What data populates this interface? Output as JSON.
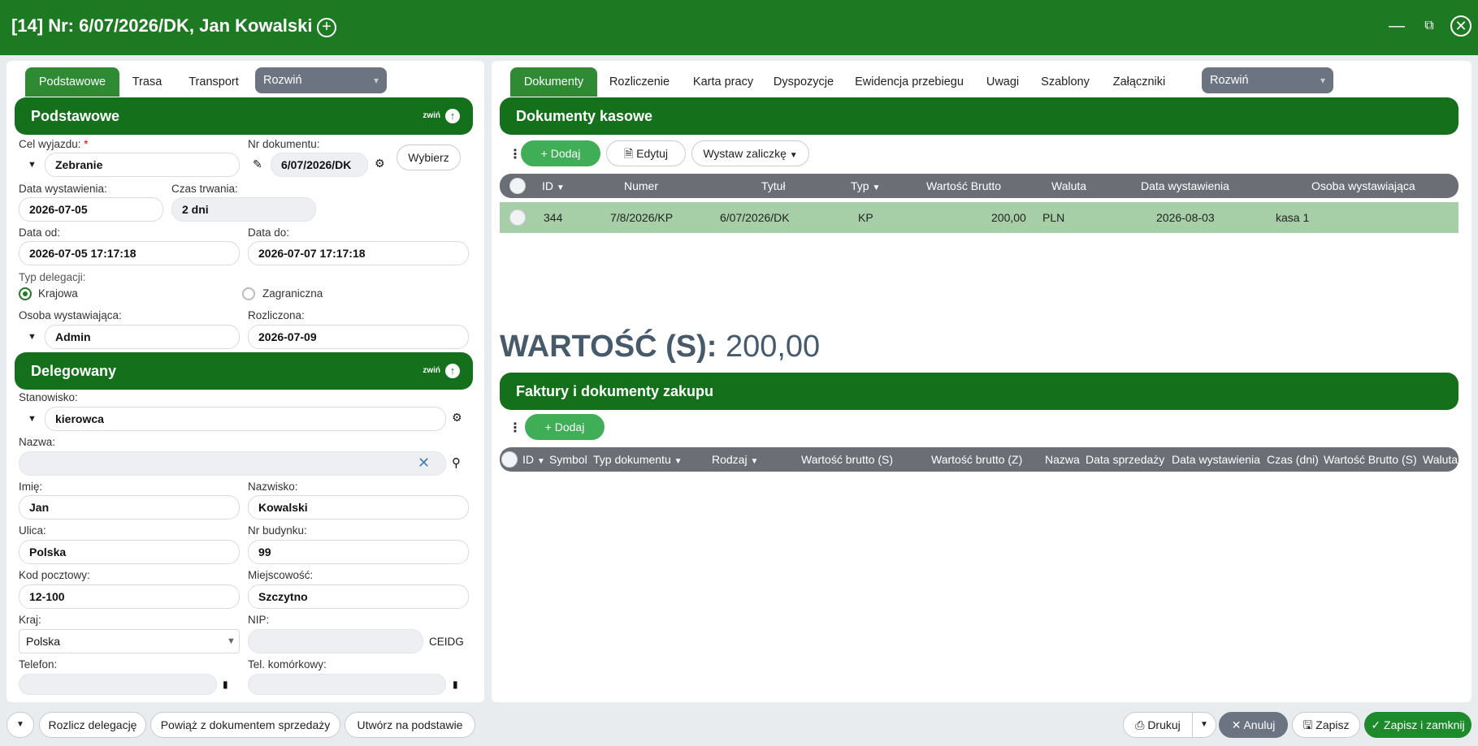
{
  "window": {
    "title": "[14] Nr: 6/07/2026/DK, Jan Kowalski"
  },
  "left_tabs": [
    {
      "label": "Podstawowe"
    },
    {
      "label": "Trasa"
    },
    {
      "label": "Transport"
    }
  ],
  "left_rozwin": "Rozwiń",
  "sections": {
    "podstawowe": "Podstawowe",
    "delegowany": "Delegowany",
    "collapse": "zwiń"
  },
  "form": {
    "cel_label": "Cel wyjazdu:",
    "cel_req": "*",
    "cel_value": "Zebranie",
    "nr_label": "Nr dokumentu:",
    "nr_value": "6/07/2026/DK",
    "wybierz": "Wybierz",
    "data_wyst_label": "Data wystawienia:",
    "data_wyst_value": "2026-07-05",
    "czas_label": "Czas trwania:",
    "czas_value": "2 dni",
    "data_od_label": "Data od:",
    "data_od_value": "2026-07-05 17:17:18",
    "data_do_label": "Data do:",
    "data_do_value": "2026-07-07 17:17:18",
    "typ_label": "Typ delegacji:",
    "typ_krajowa": "Krajowa",
    "typ_zagraniczna": "Zagraniczna",
    "osoba_label": "Osoba wystawiająca:",
    "osoba_value": "Admin",
    "rozl_label": "Rozliczona:",
    "rozl_value": "2026-07-09",
    "stan_label": "Stanowisko:",
    "stan_value": "kierowca",
    "nazwa_label": "Nazwa:",
    "nazwa_value": "",
    "imie_label": "Imię:",
    "imie_value": "Jan",
    "nazwisko_label": "Nazwisko:",
    "nazwisko_value": "Kowalski",
    "ulica_label": "Ulica:",
    "ulica_value": "Polska",
    "nrbud_label": "Nr budynku:",
    "nrbud_value": "99",
    "kod_label": "Kod pocztowy:",
    "kod_value": "12-100",
    "miejsc_label": "Miejscowość:",
    "miejsc_value": "Szczytno",
    "kraj_label": "Kraj:",
    "kraj_value": "Polska",
    "nip_label": "NIP:",
    "nip_value": "",
    "ceidg": "CEIDG",
    "tel_label": "Telefon:",
    "tel_value": "",
    "telkom_label": "Tel. komórkowy:",
    "telkom_value": ""
  },
  "right_tabs": [
    {
      "label": "Dokumenty"
    },
    {
      "label": "Rozliczenie"
    },
    {
      "label": "Karta pracy"
    },
    {
      "label": "Dyspozycje"
    },
    {
      "label": "Ewidencja przebiegu"
    },
    {
      "label": "Uwagi"
    },
    {
      "label": "Szablony"
    },
    {
      "label": "Załączniki"
    }
  ],
  "right_rozwin": "Rozwiń",
  "kasowe": {
    "title": "Dokumenty kasowe",
    "btn_dodaj": "Dodaj",
    "btn_edytuj": "Edytuj",
    "btn_zaliczka": "Wystaw zaliczkę",
    "columns": [
      "ID",
      "Numer",
      "Tytuł",
      "Typ",
      "Wartość Brutto",
      "Waluta",
      "Data wystawienia",
      "Osoba wystawiająca"
    ],
    "rows": [
      {
        "id": "344",
        "numer": "7/8/2026/KP",
        "tytul": "6/07/2026/DK",
        "typ": "KP",
        "wartosc": "200,00",
        "waluta": "PLN",
        "data": "2026-08-03",
        "osoba": "kasa 1"
      }
    ]
  },
  "wartosc": {
    "label": "WARTOŚĆ (S):",
    "value": "200,00"
  },
  "faktury": {
    "title": "Faktury i dokumenty zakupu",
    "btn_dodaj": "Dodaj",
    "columns": [
      "ID",
      "Symbol",
      "Typ dokumentu",
      "Rodzaj",
      "Wartość brutto (S)",
      "Wartość brutto (Z)",
      "Nazwa",
      "Data sprzedaży",
      "Data wystawienia",
      "Czas (dni)",
      "Wartość Brutto (S)",
      "Waluta"
    ]
  },
  "footer": {
    "rozlicz": "Rozlicz delegację",
    "powiaz": "Powiąż z dokumentem sprzedaży",
    "utworz": "Utwórz na podstawie",
    "drukuj": "Drukuj",
    "anuluj": "Anuluj",
    "zapisz": "Zapisz",
    "zapisz_zamknij": "Zapisz i zamknij"
  },
  "colors": {
    "brand": "#1e7a22",
    "section": "#15701c",
    "row_selected": "#a7cfa7"
  }
}
